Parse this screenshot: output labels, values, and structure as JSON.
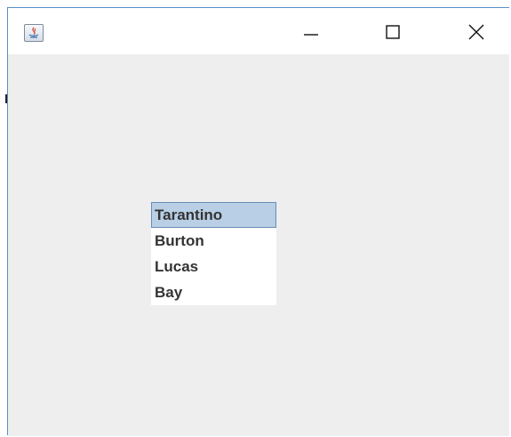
{
  "window": {
    "title": "",
    "controls": {
      "minimize_icon": "minimize-icon",
      "maximize_icon": "maximize-icon",
      "close_icon": "close-icon"
    },
    "app_icon": "java-cup-icon"
  },
  "list": {
    "items": [
      {
        "label": "Tarantino",
        "selected": true
      },
      {
        "label": "Burton",
        "selected": false
      },
      {
        "label": "Lucas",
        "selected": false
      },
      {
        "label": "Bay",
        "selected": false
      }
    ],
    "selection_color": "#b8cfe5"
  }
}
